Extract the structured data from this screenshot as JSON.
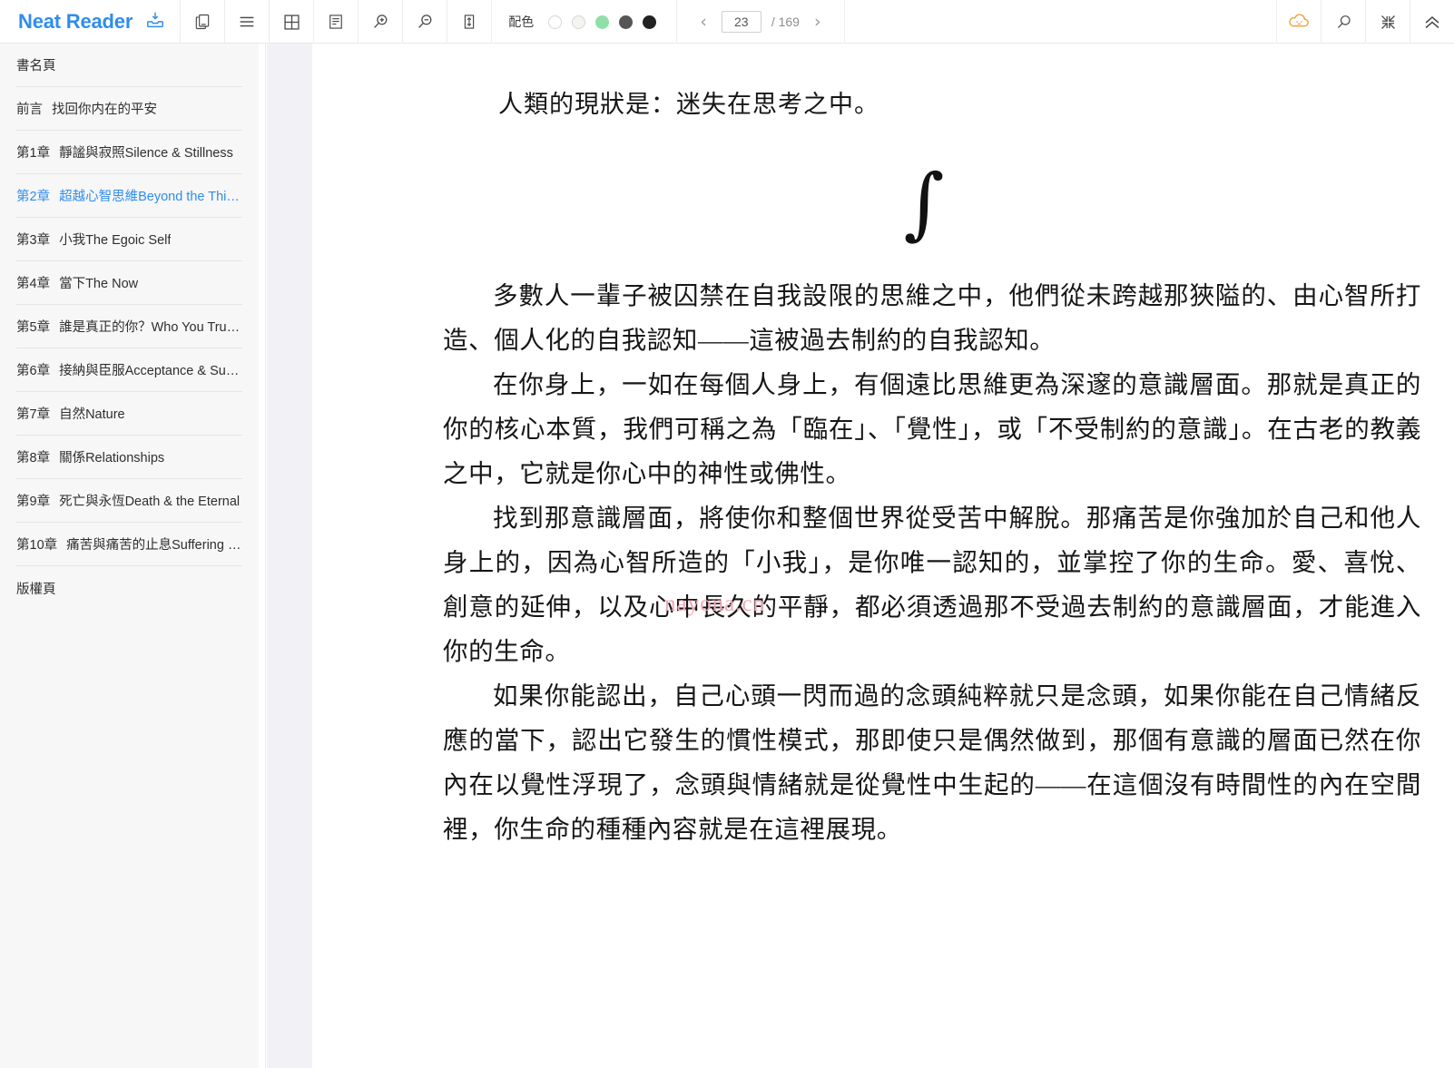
{
  "app": {
    "title": "Neat Reader",
    "brand_color": "#2f8ded"
  },
  "toolbar": {
    "icons": [
      {
        "name": "save-to-bookshelf-icon",
        "label": "save-to-bookshelf"
      },
      {
        "name": "copy-page-icon",
        "label": "copy"
      },
      {
        "name": "menu-lines-icon",
        "label": "line-spacing"
      },
      {
        "name": "grid-layout-icon",
        "label": "page-layout"
      },
      {
        "name": "text-align-icon",
        "label": "paragraph"
      },
      {
        "name": "zoom-in-icon",
        "label": "zoom-in"
      },
      {
        "name": "zoom-out-icon",
        "label": "zoom-out"
      },
      {
        "name": "fit-height-icon",
        "label": "fit-height"
      }
    ],
    "color_scheme": {
      "label": "配色",
      "swatches": [
        {
          "name": "theme-white",
          "color": "#ffffff"
        },
        {
          "name": "theme-cream",
          "color": "#f6f4ee"
        },
        {
          "name": "theme-green",
          "color": "#8fe0a8"
        },
        {
          "name": "theme-gray",
          "color": "#565656"
        },
        {
          "name": "theme-black",
          "color": "#222222"
        }
      ],
      "selected_index": 0
    },
    "pager": {
      "prev_label": "‹",
      "next_label": "›",
      "current_page": "23",
      "total_label": "/ 169",
      "placeholder": "23"
    },
    "right_icons": [
      {
        "name": "cloud-sync-icon",
        "label": "cloud",
        "color": "#f0a033"
      },
      {
        "name": "search-icon",
        "label": "search"
      },
      {
        "name": "collapse-inward-icon",
        "label": "fullscreen-exit"
      },
      {
        "name": "chevron-double-up-icon",
        "label": "hide-toolbar"
      }
    ]
  },
  "sidebar": {
    "items": [
      {
        "num": "書名頁",
        "title": "",
        "active": false
      },
      {
        "num": "前言",
        "title": "找回你内在的平安",
        "active": false
      },
      {
        "num": "第1章",
        "title": "靜謐與寂照Silence & Stillness",
        "active": false
      },
      {
        "num": "第2章",
        "title": "超越心智思維Beyond the Thi…",
        "active": true
      },
      {
        "num": "第3章",
        "title": "小我The Egoic Self",
        "active": false
      },
      {
        "num": "第4章",
        "title": "當下The Now",
        "active": false
      },
      {
        "num": "第5章",
        "title": "誰是真正的你？Who You Trul…",
        "active": false
      },
      {
        "num": "第6章",
        "title": "接納與臣服Acceptance & Su…",
        "active": false
      },
      {
        "num": "第7章",
        "title": "自然Nature",
        "active": false
      },
      {
        "num": "第8章",
        "title": "關係Relationships",
        "active": false
      },
      {
        "num": "第9章",
        "title": "死亡與永恆Death & the Eternal",
        "active": false
      },
      {
        "num": "第10章",
        "title": "痛苦與痛苦的止息Suffering …",
        "active": false
      },
      {
        "num": "版權頁",
        "title": "",
        "active": false
      }
    ]
  },
  "content": {
    "lead": "人類的現狀是：迷失在思考之中。",
    "ornament": "∫",
    "paragraphs": [
      "多數人一輩子被囚禁在自我設限的思維之中，他們從未跨越那狹隘的、由心智所打造、個人化的自我認知——這被過去制約的自我認知。",
      "在你身上，一如在每個人身上，有個遠比思維更為深邃的意識層面。那就是真正的你的核心本質，我們可稱之為「臨在」、「覺性」，或「不受制約的意識」。在古老的教義之中，它就是你心中的神性或佛性。",
      "找到那意識層面，將使你和整個世界從受苦中解脫。那痛苦是你強加於自己和他人身上的，因為心智所造的「小我」，是你唯一認知的，並掌控了你的生命。愛、喜悅、創意的延伸，以及心中長久的平靜，都必須透過那不受過去制約的意識層面，才能進入你的生命。",
      "如果你能認出，自己心頭一閃而過的念頭純粹就只是念頭，如果你能在自己情緒反應的當下，認出它發生的慣性模式，那即使只是偶然做到，那個有意識的層面已然在你內在以覺性浮現了，念頭與情緒就是從覺性中生起的——在這個沒有時間性的內在空間裡，你生命的種種內容就是在這裡展現。"
    ],
    "watermark": "nayona.cn"
  }
}
